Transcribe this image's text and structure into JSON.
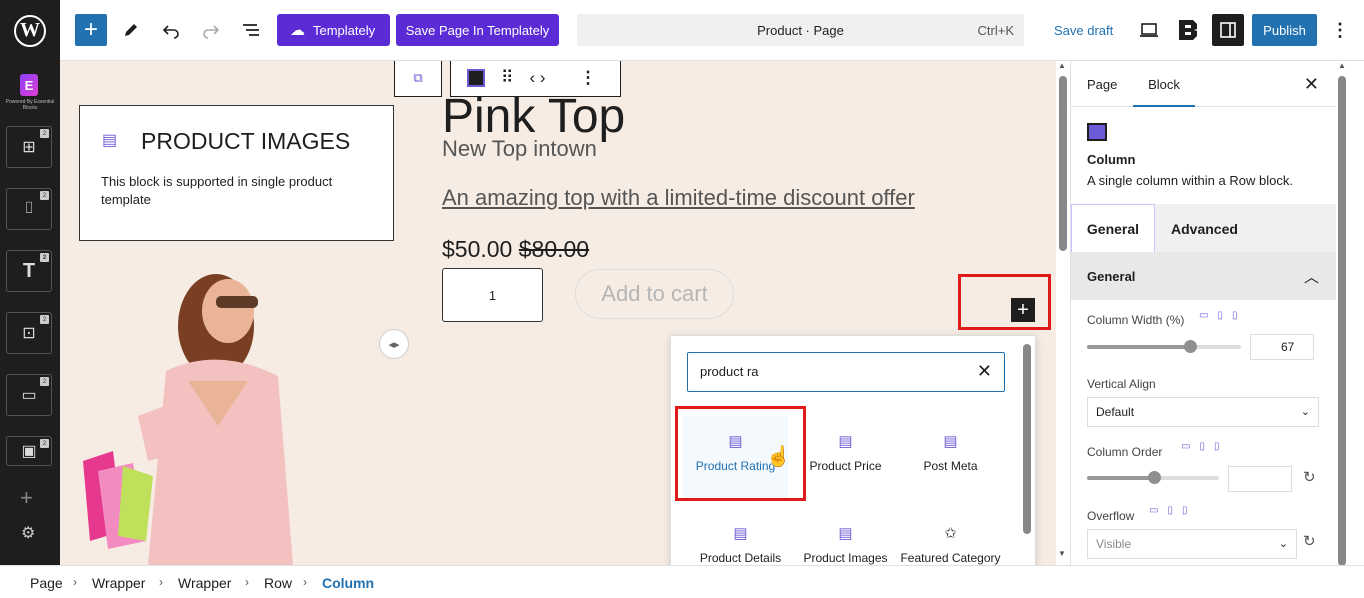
{
  "toolbar": {
    "templately_label": "Templately",
    "save_templately_label": "Save Page In Templately",
    "command_title": "Product · Page",
    "command_shortcut": "Ctrl+K",
    "save_draft_label": "Save draft",
    "publish_label": "Publish"
  },
  "leftbar": {
    "powered_text": "Powered By Essential Blocks",
    "badge": "2"
  },
  "canvas": {
    "product_images_title": "PRODUCT IMAGES",
    "product_images_desc": "This block is supported in single product template",
    "product_title": "Pink Top",
    "product_subtitle": "New Top intown",
    "product_desc": "An amazing top with a limited-time discount offer",
    "price_current": "$50.00",
    "price_old": "$80.00",
    "quantity": "1",
    "add_to_cart": "Add to cart"
  },
  "inserter": {
    "search_value": "product ra",
    "items": [
      {
        "label": "Product Rating",
        "icon": "product-rating-icon"
      },
      {
        "label": "Product Price",
        "icon": "product-price-icon"
      },
      {
        "label": "Post Meta",
        "icon": "post-meta-icon"
      },
      {
        "label": "Product Details",
        "icon": "product-details-icon"
      },
      {
        "label": "Product Images",
        "icon": "product-images-icon"
      },
      {
        "label": "Featured Category",
        "icon": "featured-category-icon"
      }
    ]
  },
  "sidebar": {
    "tab_page": "Page",
    "tab_block": "Block",
    "block_name": "Column",
    "block_desc": "A single column within a Row block.",
    "tab_general": "General",
    "tab_advanced": "Advanced",
    "panel_title": "General",
    "column_width_label": "Column Width (%)",
    "column_width_value": "67",
    "column_width_percent": 67,
    "vertical_align_label": "Vertical Align",
    "vertical_align_value": "Default",
    "column_order_label": "Column Order",
    "overflow_label": "Overflow",
    "overflow_value": "Visible"
  },
  "breadcrumbs": [
    "Page",
    "Wrapper",
    "Wrapper",
    "Row",
    "Column"
  ],
  "colors": {
    "accent": "#2271b1",
    "templately_purple": "#5b2cd6",
    "highlight_red": "#e0191b",
    "canvas_bg": "#f6ece4"
  }
}
